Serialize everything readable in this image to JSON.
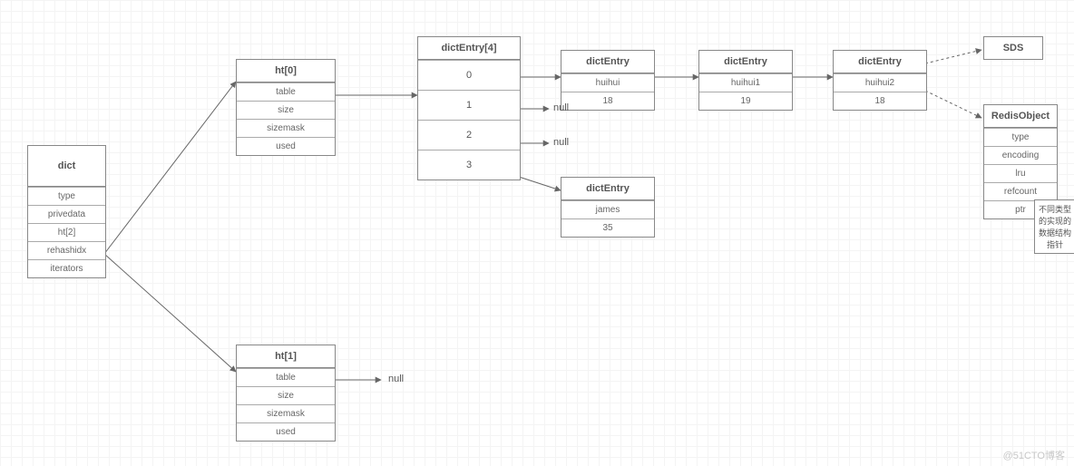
{
  "dict": {
    "title": "dict",
    "fields": [
      "type",
      "privedata",
      "ht[2]",
      "rehashidx",
      "iterators"
    ]
  },
  "ht0": {
    "title": "ht[0]",
    "fields": [
      "table",
      "size",
      "sizemask",
      "used"
    ]
  },
  "ht1": {
    "title": "ht[1]",
    "fields": [
      "table",
      "size",
      "sizemask",
      "used"
    ]
  },
  "bucket": {
    "title": "dictEntry[4]",
    "slots": [
      "0",
      "1",
      "2",
      "3"
    ]
  },
  "entry0": {
    "title": "dictEntry",
    "key": "huihui",
    "val": "18"
  },
  "entry0b": {
    "title": "dictEntry",
    "key": "huihui1",
    "val": "19"
  },
  "entry0c": {
    "title": "dictEntry",
    "key": "huihui2",
    "val": "18"
  },
  "entry3": {
    "title": "dictEntry",
    "key": "james",
    "val": "35"
  },
  "sds": {
    "title": "SDS"
  },
  "robj": {
    "title": "RedisObject",
    "fields": [
      "type",
      "encoding",
      "lru",
      "refcount",
      "ptr"
    ]
  },
  "note": {
    "line1": "不同类型的实现的",
    "line2": "数据结构指针"
  },
  "nullLabel": "null",
  "watermark": "@51CTO博客",
  "chart_data": {
    "type": "table",
    "description": "Redis dict internal structure diagram",
    "nodes": [
      {
        "id": "dict",
        "label": "dict",
        "fields": [
          "type",
          "privedata",
          "ht[2]",
          "rehashidx",
          "iterators"
        ]
      },
      {
        "id": "ht0",
        "label": "ht[0]",
        "fields": [
          "table",
          "size",
          "sizemask",
          "used"
        ]
      },
      {
        "id": "ht1",
        "label": "ht[1]",
        "fields": [
          "table",
          "size",
          "sizemask",
          "used"
        ]
      },
      {
        "id": "bucket",
        "label": "dictEntry[4]",
        "slots": [
          0,
          1,
          2,
          3
        ]
      },
      {
        "id": "e0",
        "label": "dictEntry",
        "key": "huihui",
        "val": 18
      },
      {
        "id": "e0b",
        "label": "dictEntry",
        "key": "huihui1",
        "val": 19
      },
      {
        "id": "e0c",
        "label": "dictEntry",
        "key": "huihui2",
        "val": 18
      },
      {
        "id": "e3",
        "label": "dictEntry",
        "key": "james",
        "val": 35
      },
      {
        "id": "sds",
        "label": "SDS"
      },
      {
        "id": "robj",
        "label": "RedisObject",
        "fields": [
          "type",
          "encoding",
          "lru",
          "refcount",
          "ptr"
        ]
      },
      {
        "id": "note",
        "label": "不同类型的实现的数据结构指针"
      }
    ],
    "edges": [
      {
        "from": "dict.ht[2]",
        "to": "ht0",
        "style": "solid"
      },
      {
        "from": "dict.ht[2]",
        "to": "ht1",
        "style": "solid"
      },
      {
        "from": "ht0.table",
        "to": "bucket",
        "style": "solid"
      },
      {
        "from": "ht1.table",
        "to": "null",
        "style": "solid"
      },
      {
        "from": "bucket[0]",
        "to": "e0",
        "style": "solid"
      },
      {
        "from": "bucket[1]",
        "to": "null",
        "style": "solid"
      },
      {
        "from": "bucket[2]",
        "to": "null",
        "style": "solid"
      },
      {
        "from": "bucket[3]",
        "to": "e3",
        "style": "solid"
      },
      {
        "from": "e0",
        "to": "e0b",
        "style": "solid"
      },
      {
        "from": "e0b",
        "to": "e0c",
        "style": "solid"
      },
      {
        "from": "e0c",
        "to": "sds",
        "style": "dashed"
      },
      {
        "from": "e0c",
        "to": "robj",
        "style": "dashed"
      },
      {
        "from": "robj.ptr",
        "to": "note",
        "style": "dashdot"
      }
    ]
  }
}
